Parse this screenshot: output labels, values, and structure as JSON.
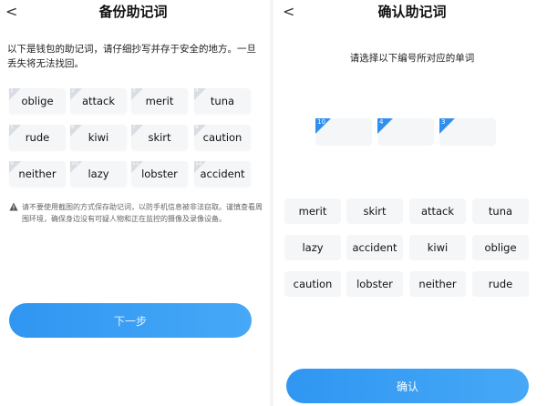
{
  "backup": {
    "back_glyph": "<",
    "title": "备份助记词",
    "description": "以下是钱包的助记词，请仔细抄写并存于安全的地方。一旦丢失将无法找回。",
    "words": [
      {
        "num": "1",
        "word": "oblige"
      },
      {
        "num": "2",
        "word": "attack"
      },
      {
        "num": "3",
        "word": "merit"
      },
      {
        "num": "4",
        "word": "tuna"
      },
      {
        "num": "5",
        "word": "rude"
      },
      {
        "num": "6",
        "word": "kiwi"
      },
      {
        "num": "7",
        "word": "skirt"
      },
      {
        "num": "8",
        "word": "caution"
      },
      {
        "num": "9",
        "word": "neither"
      },
      {
        "num": "10",
        "word": "lazy"
      },
      {
        "num": "11",
        "word": "lobster"
      },
      {
        "num": "12",
        "word": "accident"
      }
    ],
    "warning": "请不要使用截图的方式保存助记词，以防手机信息被非法窃取。谨慎查看周围环境，确保身边没有可疑人物和正在监控的摄像及录像设备。",
    "next_label": "下一步"
  },
  "confirm": {
    "back_glyph": "<",
    "title": "确认助记词",
    "prompt": "请选择以下编号所对应的单词",
    "slots": [
      {
        "num": "10"
      },
      {
        "num": "4"
      },
      {
        "num": "3"
      }
    ],
    "choices": [
      "merit",
      "skirt",
      "attack",
      "tuna",
      "lazy",
      "accident",
      "kiwi",
      "oblige",
      "caution",
      "lobster",
      "neither",
      "rude"
    ],
    "confirm_label": "确认"
  },
  "colors": {
    "accent": "#2f96f2",
    "slot_marker": "#2f8ff0",
    "cell_bg": "#f5f6f8"
  }
}
